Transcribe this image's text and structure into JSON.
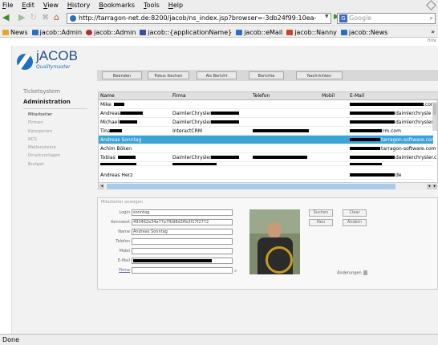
{
  "browser": {
    "menu": [
      "File",
      "Edit",
      "View",
      "History",
      "Bookmarks",
      "Tools",
      "Help"
    ],
    "url": "http://tarragon-net.de:8200/jacob/ns_index.jsp?browser=-3db24f99:10ea-",
    "search_placeholder": "Google",
    "bookmarks": [
      {
        "label": "News",
        "color": "#e0a92a"
      },
      {
        "label": "jacob::Admin",
        "color": "#2a6fc6"
      },
      {
        "label": "jacob::Admin",
        "color": "#a8322a"
      },
      {
        "label": "jacob::{applicationName}",
        "color": "#3b4fa0"
      },
      {
        "label": "jacob::eMail",
        "color": "#2a6fc6"
      },
      {
        "label": "jacob::Nanny",
        "color": "#c24a2a"
      },
      {
        "label": "jacob::News",
        "color": "#2a6fc6"
      }
    ],
    "bookmarks_more": "»",
    "status": "Done"
  },
  "app": {
    "hilfe": "Hilfe",
    "logo": {
      "brand": "jACOB",
      "tagline": "Qualitymaster"
    },
    "sidebar": {
      "heading": "Ticketsystem",
      "section": "Administration",
      "items": [
        {
          "label": "Mitarbeiter",
          "active": true
        },
        {
          "label": "Firmen",
          "active": false
        },
        {
          "label": "Kategorien",
          "active": false
        },
        {
          "label": "RCS",
          "active": false
        },
        {
          "label": "Meilensteine",
          "active": false
        },
        {
          "label": "Druckvorlagen",
          "active": false
        },
        {
          "label": "Budget",
          "active": false
        }
      ]
    },
    "toolbar": [
      "Beenden",
      "Fokus löschen",
      "Als Bericht",
      "Berichte",
      "Nachrichten"
    ],
    "grid": {
      "columns": [
        "Name",
        "Firma",
        "Telefon",
        "Mobil",
        "E-Mail"
      ],
      "rows": [
        {
          "name": "Mike",
          "firma": "",
          "email": ".com"
        },
        {
          "name": "Andreas",
          "firma": "DaimlerChrysler",
          "email": "daimlerchrysle"
        },
        {
          "name": "Michael",
          "firma": "DaimlerChrysler",
          "email": "daimlerchrysler.c"
        },
        {
          "name": "Tina",
          "firma": "InteractCRM",
          "email": "rm.com"
        },
        {
          "name": "Andreas Sonntag",
          "firma": "",
          "email": "tarragon-software.com",
          "selected": true
        },
        {
          "name": "Achim Böken",
          "firma": "",
          "email": "tarragon-software.com"
        },
        {
          "name": "Tobias",
          "firma": "DaimlerChrysler",
          "email": "daimlerchrysler.c"
        },
        {
          "name": "",
          "firma": "",
          "email": ""
        },
        {
          "name": "Andreas Herz",
          "firma": "",
          "email": "de"
        }
      ]
    },
    "detail": {
      "title": "Mitarbeiter anzeigen",
      "fields": [
        {
          "label": "Login",
          "value": "sonntag"
        },
        {
          "label": "Kennwort",
          "value": "493462e34a77e7fb98d3ffe3f17f2772"
        },
        {
          "label": "Name",
          "value": "Andreas Sonntag"
        },
        {
          "label": "Telefon",
          "value": ""
        },
        {
          "label": "Mobil",
          "value": ""
        },
        {
          "label": "E-Mail",
          "value": ""
        },
        {
          "label": "Firma",
          "value": ""
        }
      ],
      "buttons": {
        "suchen": "Suchen",
        "clear": "Clear",
        "neu": "Neu",
        "aendern": "Ändern"
      },
      "aenderungen": "Änderungen"
    }
  }
}
